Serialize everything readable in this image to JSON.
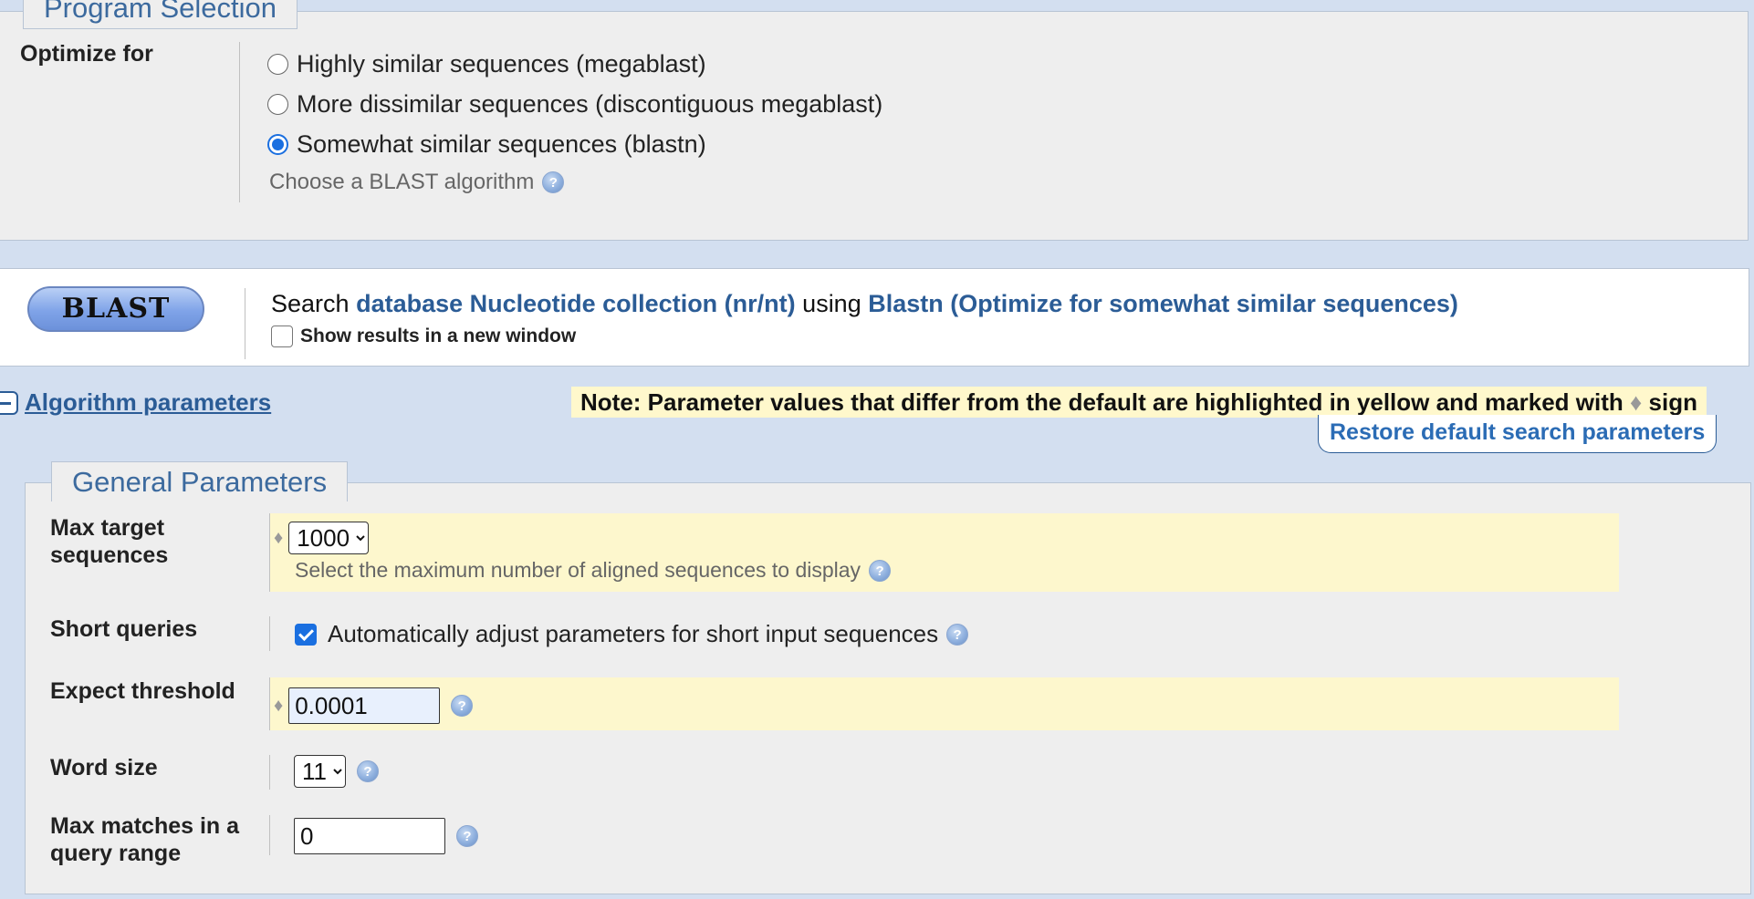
{
  "program_selection": {
    "legend": "Program Selection",
    "optimize_label": "Optimize for",
    "options": [
      {
        "label": "Highly similar sequences (megablast)",
        "checked": false
      },
      {
        "label": "More dissimilar sequences (discontiguous megablast)",
        "checked": false
      },
      {
        "label": "Somewhat similar sequences (blastn)",
        "checked": true
      }
    ],
    "hint": "Choose a BLAST algorithm"
  },
  "blast": {
    "button_label": "BLAST",
    "search_prefix": "Search",
    "database_link": "database Nucleotide collection (nr/nt)",
    "using": "using",
    "program_link": "Blastn (Optimize for somewhat similar sequences)",
    "new_window_label": "Show results in a new window",
    "new_window_checked": false
  },
  "algorithm": {
    "toggle_label": "Algorithm parameters",
    "note_text": "Note: Parameter values that differ from the default are highlighted in yellow and marked with",
    "note_sign": "♦",
    "note_suffix": "sign",
    "restore_label": "Restore default search parameters"
  },
  "general": {
    "legend": "General Parameters",
    "max_target": {
      "label_line1": "Max target",
      "label_line2": "sequences",
      "value": "1000",
      "hint": "Select the maximum number of aligned sequences to display",
      "modified": true
    },
    "short_queries": {
      "label": "Short queries",
      "checkbox_label": "Automatically adjust parameters for short input sequences",
      "checked": true
    },
    "expect": {
      "label": "Expect threshold",
      "value": "0.0001",
      "modified": true
    },
    "word_size": {
      "label": "Word size",
      "value": "11"
    },
    "max_matches": {
      "label_line1": "Max matches in a",
      "label_line2": "query range",
      "value": "0"
    }
  },
  "icons": {
    "help": "help-icon",
    "collapse": "minus-icon",
    "modified_marker": "diamond-icon"
  },
  "colors": {
    "page_bg": "#d3dff0",
    "panel_bg": "#eeeeee",
    "link": "#2b5c96",
    "highlight": "#fdf7cd",
    "accent": "#1a6fe0"
  }
}
